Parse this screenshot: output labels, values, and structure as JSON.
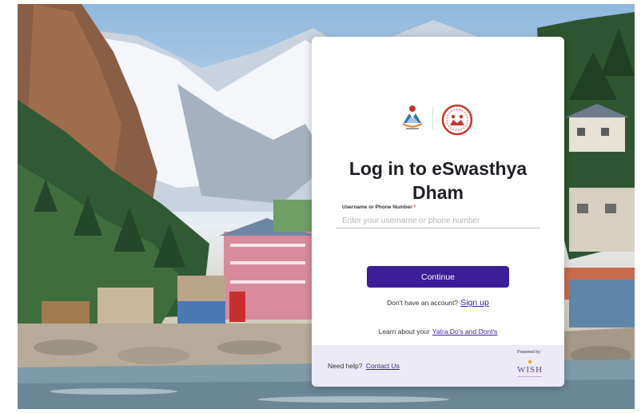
{
  "theme": {
    "accent": "#3b1d97",
    "footer_bg": "#eceaf6",
    "title_color": "#1e1e24"
  },
  "login": {
    "title": "Log in to eSwasthya Dham",
    "field_label": "Username or Phone Number",
    "required_mark": "*",
    "field_placeholder": "Enter your username or phone number",
    "field_value": "",
    "continue_label": "Continue",
    "signup_prompt": "Don't have an account?",
    "signup_link": "Sign up",
    "learn_prompt": "Learn about your",
    "learn_link": "Yatra Do's and Dont's"
  },
  "footer": {
    "help_prompt": "Need help?",
    "help_link": "Contact Us",
    "powered_by": "Powered by",
    "brand": "WISH"
  },
  "icons": {
    "left_logo": "state-emblem-icon",
    "right_logo": "health-department-emblem-icon",
    "brand_logo": "wish-logo-icon"
  }
}
